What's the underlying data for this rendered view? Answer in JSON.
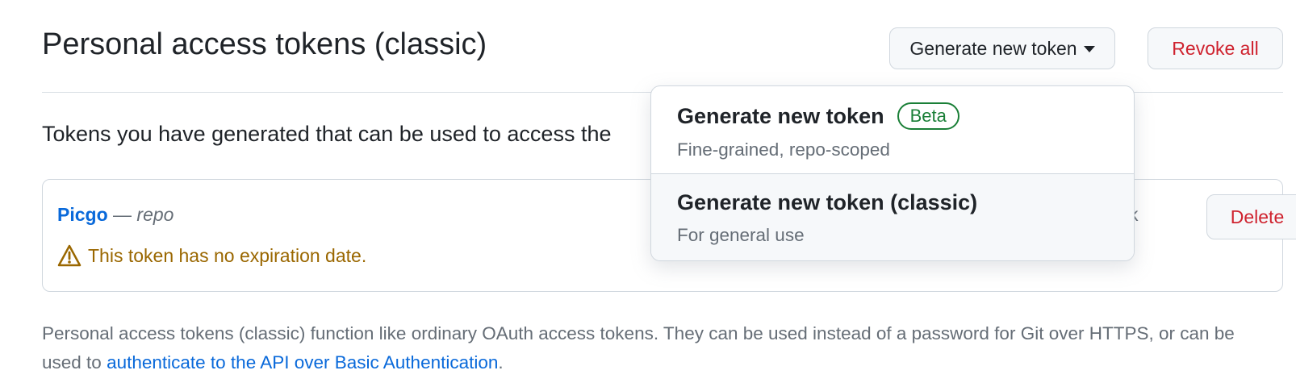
{
  "header": {
    "title": "Personal access tokens (classic)",
    "generate_label": "Generate new token",
    "revoke_label": "Revoke all"
  },
  "intro": {
    "text": "Tokens you have generated that can be used to access the"
  },
  "tokens": [
    {
      "name": "Picgo",
      "separator": "—",
      "scope": "repo",
      "warning": "This token has no expiration date.",
      "last_used_fragment": "k",
      "delete_label": "Delete"
    }
  ],
  "dropdown": {
    "items": [
      {
        "title": "Generate new token",
        "badge": "Beta",
        "description": "Fine-grained, repo-scoped"
      },
      {
        "title": "Generate new token (classic)",
        "description": "For general use"
      }
    ]
  },
  "footnote": {
    "text": "Personal access tokens (classic) function like ordinary OAuth access tokens. They can be used instead of a password for Git over HTTPS, or can be used to ",
    "link": "authenticate to the API over Basic Authentication",
    "end": "."
  },
  "colors": {
    "link": "#0969da",
    "danger": "#cf222e",
    "warning": "#9a6700",
    "success": "#1a7f37"
  },
  "icons": {
    "warning": "alert-triangle-icon",
    "caret": "caret-down-icon"
  }
}
